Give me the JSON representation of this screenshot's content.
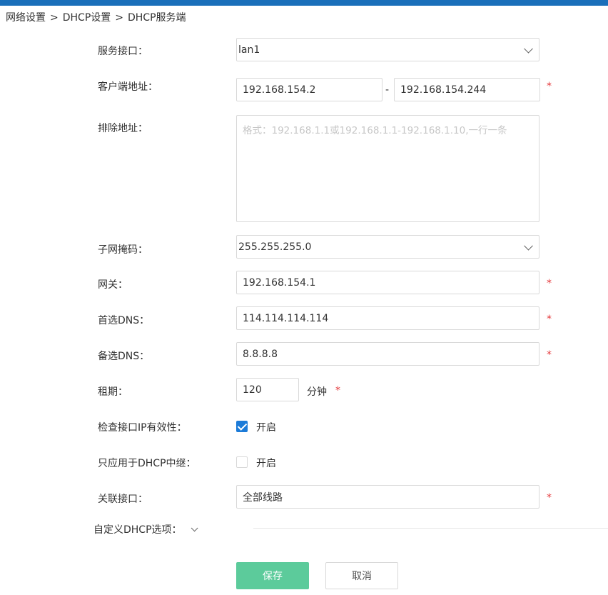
{
  "breadcrumb": {
    "network": "网络设置",
    "dhcp": "DHCP设置",
    "server": "DHCP服务端",
    "sep": ">"
  },
  "form": {
    "interface": {
      "label": "服务接口：",
      "value": "lan1"
    },
    "client_range": {
      "label": "客户端地址：",
      "start": "192.168.154.2",
      "end": "192.168.154.244",
      "dash": "-"
    },
    "exclude": {
      "label": "排除地址：",
      "placeholder": "格式：192.168.1.1或192.168.1.1-192.168.1.10,一行一条"
    },
    "subnet": {
      "label": "子网掩码：",
      "value": "255.255.255.0"
    },
    "gateway": {
      "label": "网关：",
      "value": "192.168.154.1"
    },
    "dns1": {
      "label": "首选DNS：",
      "value": "114.114.114.114"
    },
    "dns2": {
      "label": "备选DNS：",
      "value": "8.8.8.8"
    },
    "lease": {
      "label": "租期：",
      "value": "120",
      "unit": "分钟"
    },
    "check_ip": {
      "label": "检查接口IP有效性：",
      "option": "开启",
      "checked": true
    },
    "relay_only": {
      "label": "只应用于DHCP中继：",
      "option": "开启",
      "checked": false
    },
    "link_iface": {
      "label": "关联接口：",
      "value": "全部线路"
    },
    "required_mark": "*"
  },
  "advanced": {
    "label": "自定义DHCP选项："
  },
  "buttons": {
    "save": "保存",
    "cancel": "取消"
  },
  "colors": {
    "topbar": "#1a6fba",
    "primary": "#5ccb9b",
    "checkbox": "#1c7bd8",
    "required": "#e4393c"
  }
}
